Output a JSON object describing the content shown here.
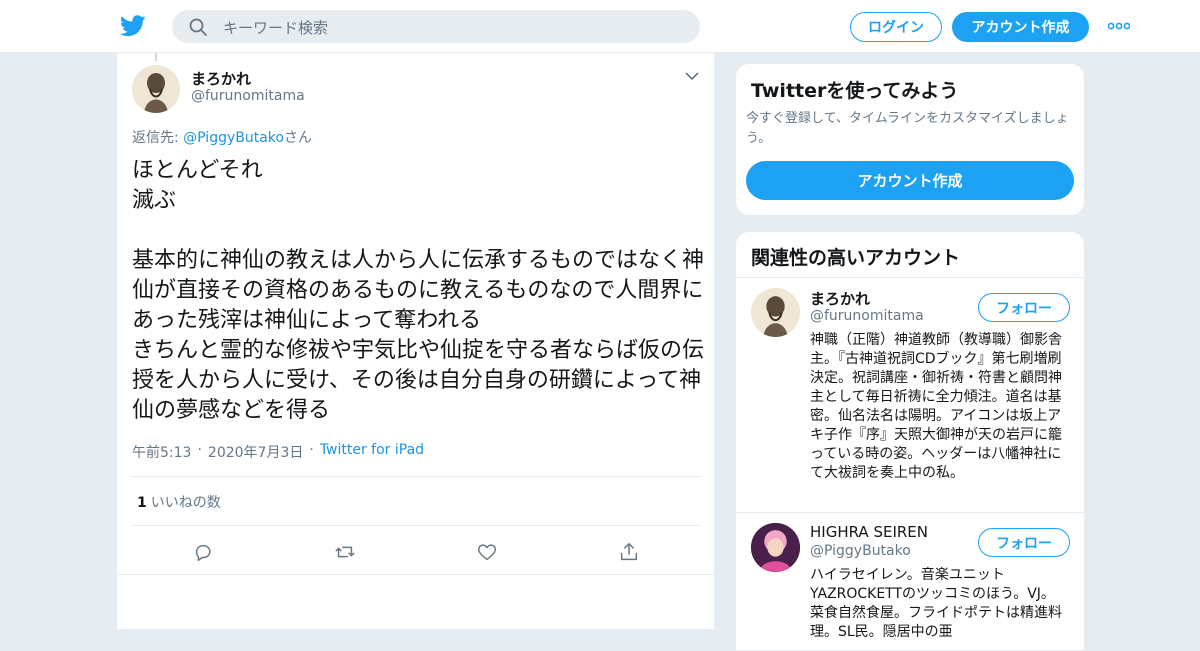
{
  "header": {
    "search_placeholder": "キーワード検索",
    "login_label": "ログイン",
    "signup_label": "アカウント作成",
    "brand_color": "#1da1f2",
    "icons": [
      "twitter-bird-icon",
      "search-icon",
      "more-icon"
    ]
  },
  "tweet": {
    "author_name": "まろかれ",
    "author_handle": "@furunomitama",
    "reply_prefix": "返信先: ",
    "reply_mention": "@PiggyButako",
    "reply_suffix": "さん",
    "text": "ほとんどそれ\n滅ぶ\n\n基本的に神仙の教えは人から人に伝承するものではなく神仙が直接その資格のあるものに教えるものなので人間界にあった残滓は神仙によって奪われる\nきちんと霊的な修祓や宇気比や仙掟を守る者ならば仮の伝授を人から人に受け、その後は自分自身の研鑽によって神仙の夢感などを得る",
    "time": "午前5:13",
    "date": "2020年7月3日",
    "sep": "·",
    "source": "Twitter for iPad",
    "like_count": "1",
    "like_label": "いいねの数",
    "actions": [
      "reply-icon",
      "retweet-icon",
      "like-icon",
      "share-icon"
    ]
  },
  "sidebar": {
    "signup_card": {
      "title": "Twitterを使ってみよう",
      "subtitle": "今すぐ登録して、タイムラインをカスタマイズしましょう。",
      "button": "アカウント作成"
    },
    "related": {
      "title": "関連性の高いアカウント",
      "accounts": [
        {
          "name": "まろかれ",
          "handle": "@furunomitama",
          "follow": "フォロー",
          "bio": "神職（正階）神道教師（教導職）御影舎主。『古神道祝詞CDブック』第七刷増刷決定。祝詞講座・御祈祷・符書と顧問神主として毎日祈祷に全力傾注。道名は基密。仙名法名は陽明。アイコンは坂上アキ子作『序』天照大御神が天の岩戸に籠っている時の姿。ヘッダーは八幡神社にて大祓詞を奏上中の私。"
        },
        {
          "name": "HIGHRA SEIREN",
          "handle": "@PiggyButako",
          "follow": "フォロー",
          "bio": "ハイラセイレン。音楽ユニットYAZROCKETTのツッコミのほう。VJ。 菜食自然食屋。フライドポテトは精進料理。SL民。隠居中の亜"
        }
      ]
    }
  }
}
